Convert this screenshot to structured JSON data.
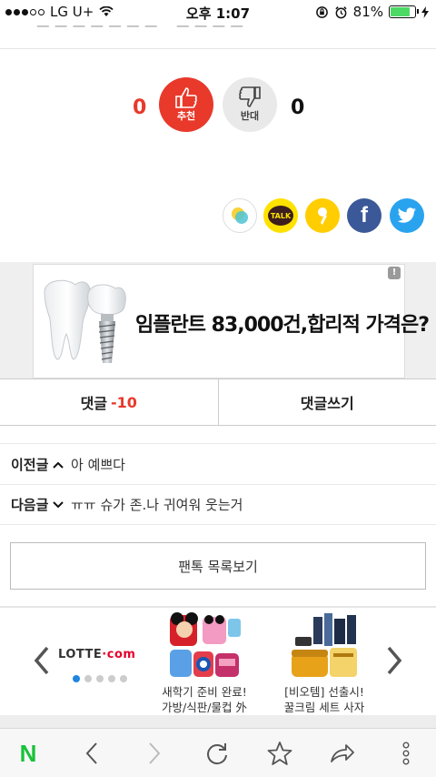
{
  "status": {
    "carrier": "LG U+",
    "time": "오후 1:07",
    "battery": "81%",
    "battery_level": 0.81
  },
  "top_cut_text": "...",
  "vote": {
    "up_count": "0",
    "up_label": "추천",
    "down_count": "0",
    "down_label": "반대",
    "up_color": "#e8392b"
  },
  "share": {
    "items": [
      "story-icon",
      "kakaotalk-icon",
      "kakaostory-icon",
      "facebook-icon",
      "twitter-icon"
    ],
    "talk_label": "TALK"
  },
  "ad": {
    "badge": "!",
    "text": "임플란트 83,000건,합리적 가격은?"
  },
  "comments": {
    "label": "댓글",
    "count": "-10",
    "write_label": "댓글쓰기"
  },
  "prev": {
    "label": "이전글",
    "title": "아 예쁘다"
  },
  "next": {
    "label": "다음글",
    "title": "ㅠㅠ 슈가 존.나 귀여워 웃는거"
  },
  "list_button": "팬톡 목록보기",
  "carousel": {
    "brand_a": "LOTTE",
    "brand_b": "·com",
    "pages": 5,
    "active_page": 1,
    "products": [
      {
        "line1": "새학기 준비 완료!",
        "line2": "가방/식판/물컵 外"
      },
      {
        "line1": "[비오템] 선출시!",
        "line2": "꿀크림 세트 사자"
      }
    ]
  }
}
